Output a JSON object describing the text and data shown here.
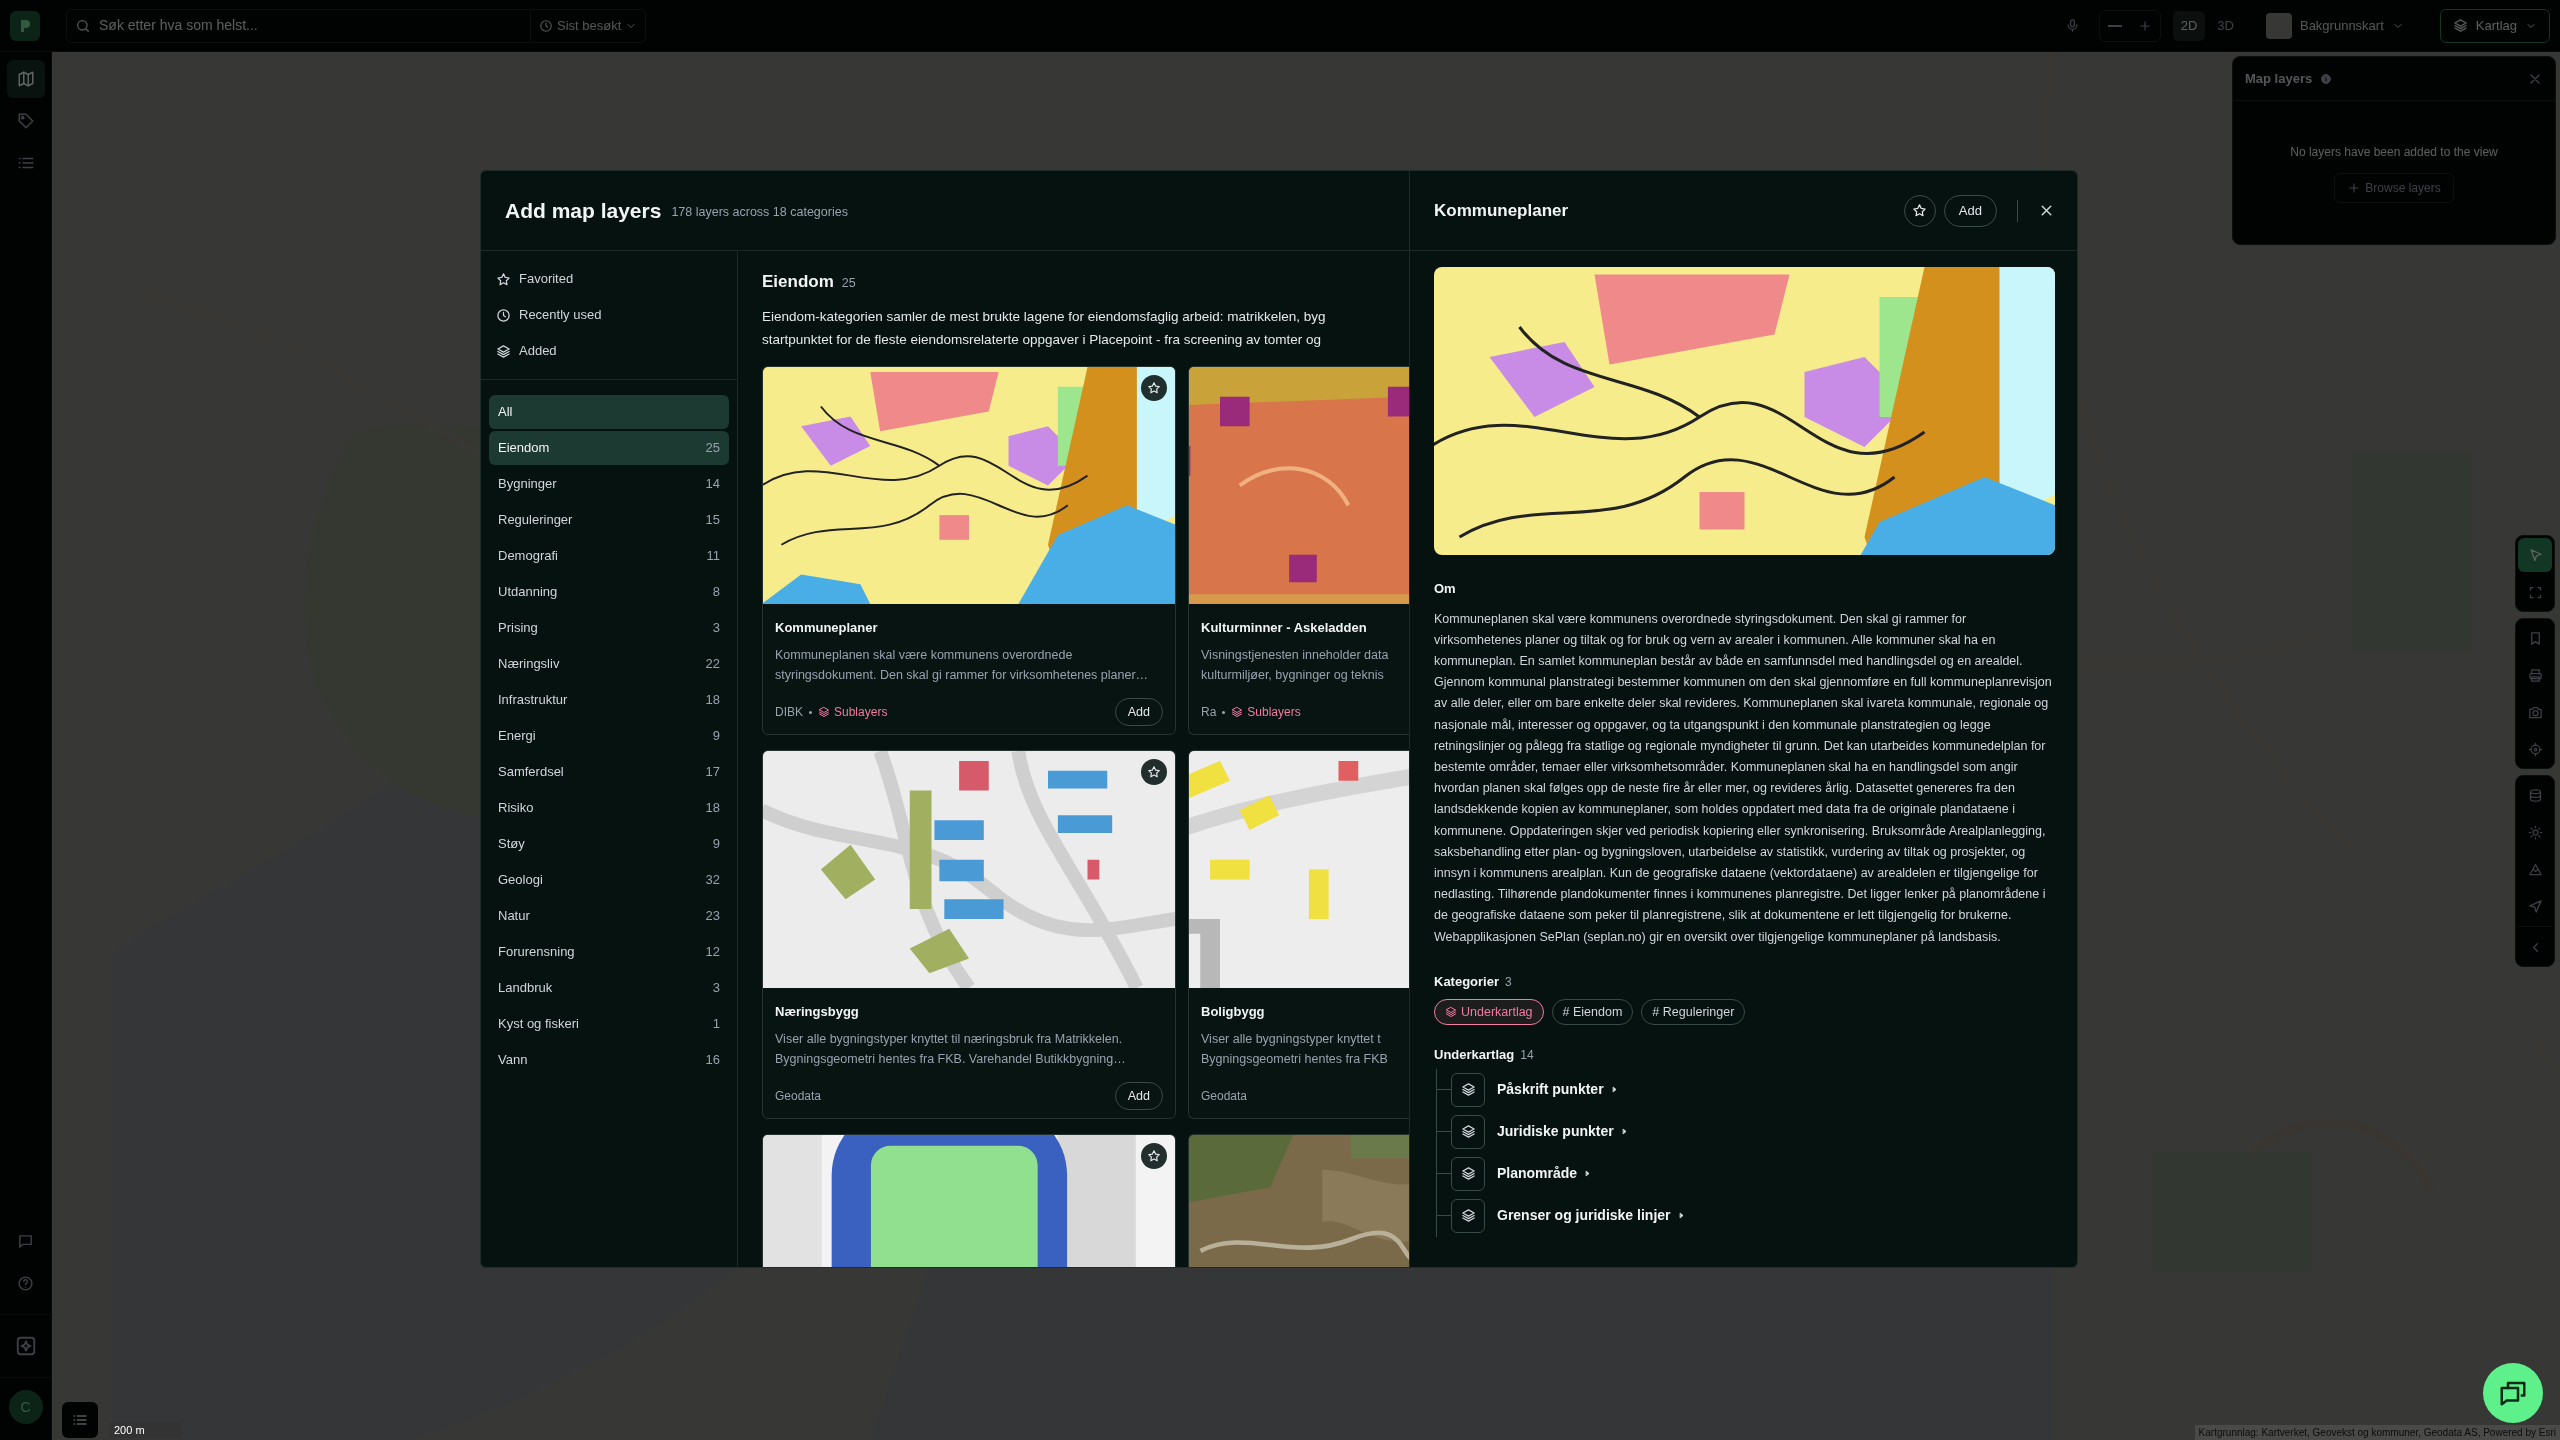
{
  "top_bar": {
    "search": {
      "placeholder": "Søk etter hva som helst..."
    },
    "recent": "Sist besøkt",
    "view_modes": [
      {
        "label": "2D",
        "selected": true
      },
      {
        "label": "3D",
        "selected": false
      }
    ],
    "basemap": "Bakgrunnskart",
    "layers_button": "Kartlag"
  },
  "left_rail": {
    "items": [
      {
        "selected": true
      },
      {
        "selected": false
      },
      {
        "selected": false
      }
    ],
    "avatar": "C"
  },
  "layers_panel": {
    "title": "Map layers",
    "empty_text": "No layers have been added to the view",
    "browse_button": "Browse layers"
  },
  "map_tools": [
    {
      "selected": true
    },
    {
      "selected": false
    },
    {
      "selected": false
    },
    {
      "selected": false
    },
    {
      "selected": false
    },
    {
      "selected": false
    },
    {
      "selected": false
    },
    {
      "selected": false
    },
    {
      "selected": false
    },
    {
      "selected": false
    },
    {
      "selected": false
    }
  ],
  "scale": "200 m",
  "attribution": "Kartgrunnlag: Kartverket, Geovekst og kommuner, Geodata AS, Powered by Esri",
  "dialog": {
    "title": "Add map layers",
    "subtitle": "178 layers across 18 categories",
    "quick_filters": [
      {
        "label": "Favorited"
      },
      {
        "label": "Recently used"
      },
      {
        "label": "Added"
      }
    ],
    "categories": [
      {
        "label": "All",
        "selected": true
      },
      {
        "label": "Eiendom",
        "count": "25",
        "selected": true
      },
      {
        "label": "Bygninger",
        "count": "14",
        "selected": false
      },
      {
        "label": "Reguleringer",
        "count": "15",
        "selected": false
      },
      {
        "label": "Demografi",
        "count": "11",
        "selected": false
      },
      {
        "label": "Utdanning",
        "count": "8",
        "selected": false
      },
      {
        "label": "Prising",
        "count": "3",
        "selected": false
      },
      {
        "label": "Næringsliv",
        "count": "22",
        "selected": false
      },
      {
        "label": "Infrastruktur",
        "count": "18",
        "selected": false
      },
      {
        "label": "Energi",
        "count": "9",
        "selected": false
      },
      {
        "label": "Samferdsel",
        "count": "17",
        "selected": false
      },
      {
        "label": "Risiko",
        "count": "18",
        "selected": false
      },
      {
        "label": "Støy",
        "count": "9",
        "selected": false
      },
      {
        "label": "Geologi",
        "count": "32",
        "selected": false
      },
      {
        "label": "Natur",
        "count": "23",
        "selected": false
      },
      {
        "label": "Forurensning",
        "count": "12",
        "selected": false
      },
      {
        "label": "Landbruk",
        "count": "3",
        "selected": false
      },
      {
        "label": "Kyst og fiskeri",
        "count": "1",
        "selected": false
      },
      {
        "label": "Vann",
        "count": "16",
        "selected": false
      }
    ],
    "section": {
      "title": "Eiendom",
      "count": "25",
      "description_lines": [
        "Eiendom-kategorien samler de mest brukte lagene for eiendomsfaglig arbeid: matrikkelen, byg",
        "startpunktet for de fleste eiendomsrelaterte oppgaver i Placepoint - fra screening av tomter og"
      ]
    },
    "cards": [
      {
        "kind": "layer",
        "title": "Kommuneplaner",
        "description_lines": [
          "Kommuneplanen skal være kommunens overordnede",
          "styringsdokument. Den skal gi rammer for virksomhetenes planer…"
        ],
        "source": "DIBK",
        "sublayers": "Sublayers",
        "add": "Add",
        "favorited": false
      },
      {
        "kind": "layer",
        "title": "Kulturminner - Askeladden",
        "description_lines": [
          "Visningstjenesten inneholder data",
          "kulturmiljøer, bygninger og teknis"
        ],
        "source": "Ra",
        "sublayers": "Sublayers"
      },
      {
        "kind": "layer",
        "title": "Næringsbygg",
        "description_lines": [
          "Viser alle bygningstyper knyttet til næringsbruk fra Matrikkelen.",
          "Bygningsgeometri hentes fra FKB. Varehandel Butikkbygning…"
        ],
        "source": "Geodata",
        "add": "Add",
        "favorited": false
      },
      {
        "kind": "layer",
        "title": "Boligbygg",
        "description_lines": [
          "Viser alle bygningstyper knyttet t",
          "Bygningsgeometri hentes fra FKB"
        ],
        "source": "Geodata"
      },
      {
        "kind": "picture",
        "favorited": false
      },
      {
        "kind": "picture"
      }
    ],
    "detail": {
      "title": "Kommuneplaner",
      "favorited": false,
      "add": "Add",
      "about_heading": "Om",
      "about": "Kommuneplanen skal være kommunens overordnede styringsdokument. Den skal gi rammer for virksomhetenes planer og tiltak og for bruk og vern av arealer i kommunen. Alle kommuner skal ha en kommuneplan. En samlet kommuneplan består av både en samfunnsdel med handlingsdel og en arealdel. Gjennom kommunal planstrategi bestemmer kommunen om den skal gjennomføre en full kommuneplanrevisjon av alle deler, eller om bare enkelte deler skal revideres. Kommuneplanen skal ivareta kommunale, regionale og nasjonale mål, interesser og oppgaver, og ta utgangspunkt i den kommunale planstrategien og legge retningslinjer og pålegg fra statlige og regionale myndigheter til grunn. Det kan utarbeides kommunedelplan for bestemte områder, temaer eller virksomhetsområder. Kommuneplanen skal ha en handlingsdel som angir hvordan planen skal følges opp de neste fire år eller mer, og revideres årlig. Datasettet genereres fra den landsdekkende kopien av kommuneplaner, som holdes oppdatert med data fra de originale plandataene i kommunene. Oppdateringen skjer ved periodisk kopiering eller synkronisering. Bruksområde Arealplanlegging, saksbehandling etter plan- og bygningsloven, utarbeidelse av statistikk, vurdering av tiltak og prosjekter, og innsyn i kommunens arealplan. Kun de geografiske dataene (vektordataene) av arealdelen er tilgjengelige for nedlasting. Tilhørende plandokumenter finnes i kommunenes planregistre. Det ligger lenker på planområdene i de geografiske dataene som peker til planregistrene, slik at dokumentene er lett tilgjengelig for brukerne. Webapplikasjonen SePlan (seplan.no) gir en oversikt over tilgjengelige kommuneplaner på landsbasis.",
      "categories_heading": "Kategorier",
      "categories_count": "3",
      "chips": [
        {
          "kind": "sublayers",
          "label": "Underkartlag"
        },
        {
          "kind": "tag",
          "label": "# Eiendom"
        },
        {
          "kind": "tag",
          "label": "# Reguleringer"
        }
      ],
      "sublayers_heading": "Underkartlag",
      "sublayers_count": "14",
      "sublayers": [
        {
          "label": "Påskrift punkter"
        },
        {
          "label": "Juridiske punkter"
        },
        {
          "label": "Planområde"
        },
        {
          "label": "Grenser og juridiske linjer"
        }
      ]
    }
  }
}
